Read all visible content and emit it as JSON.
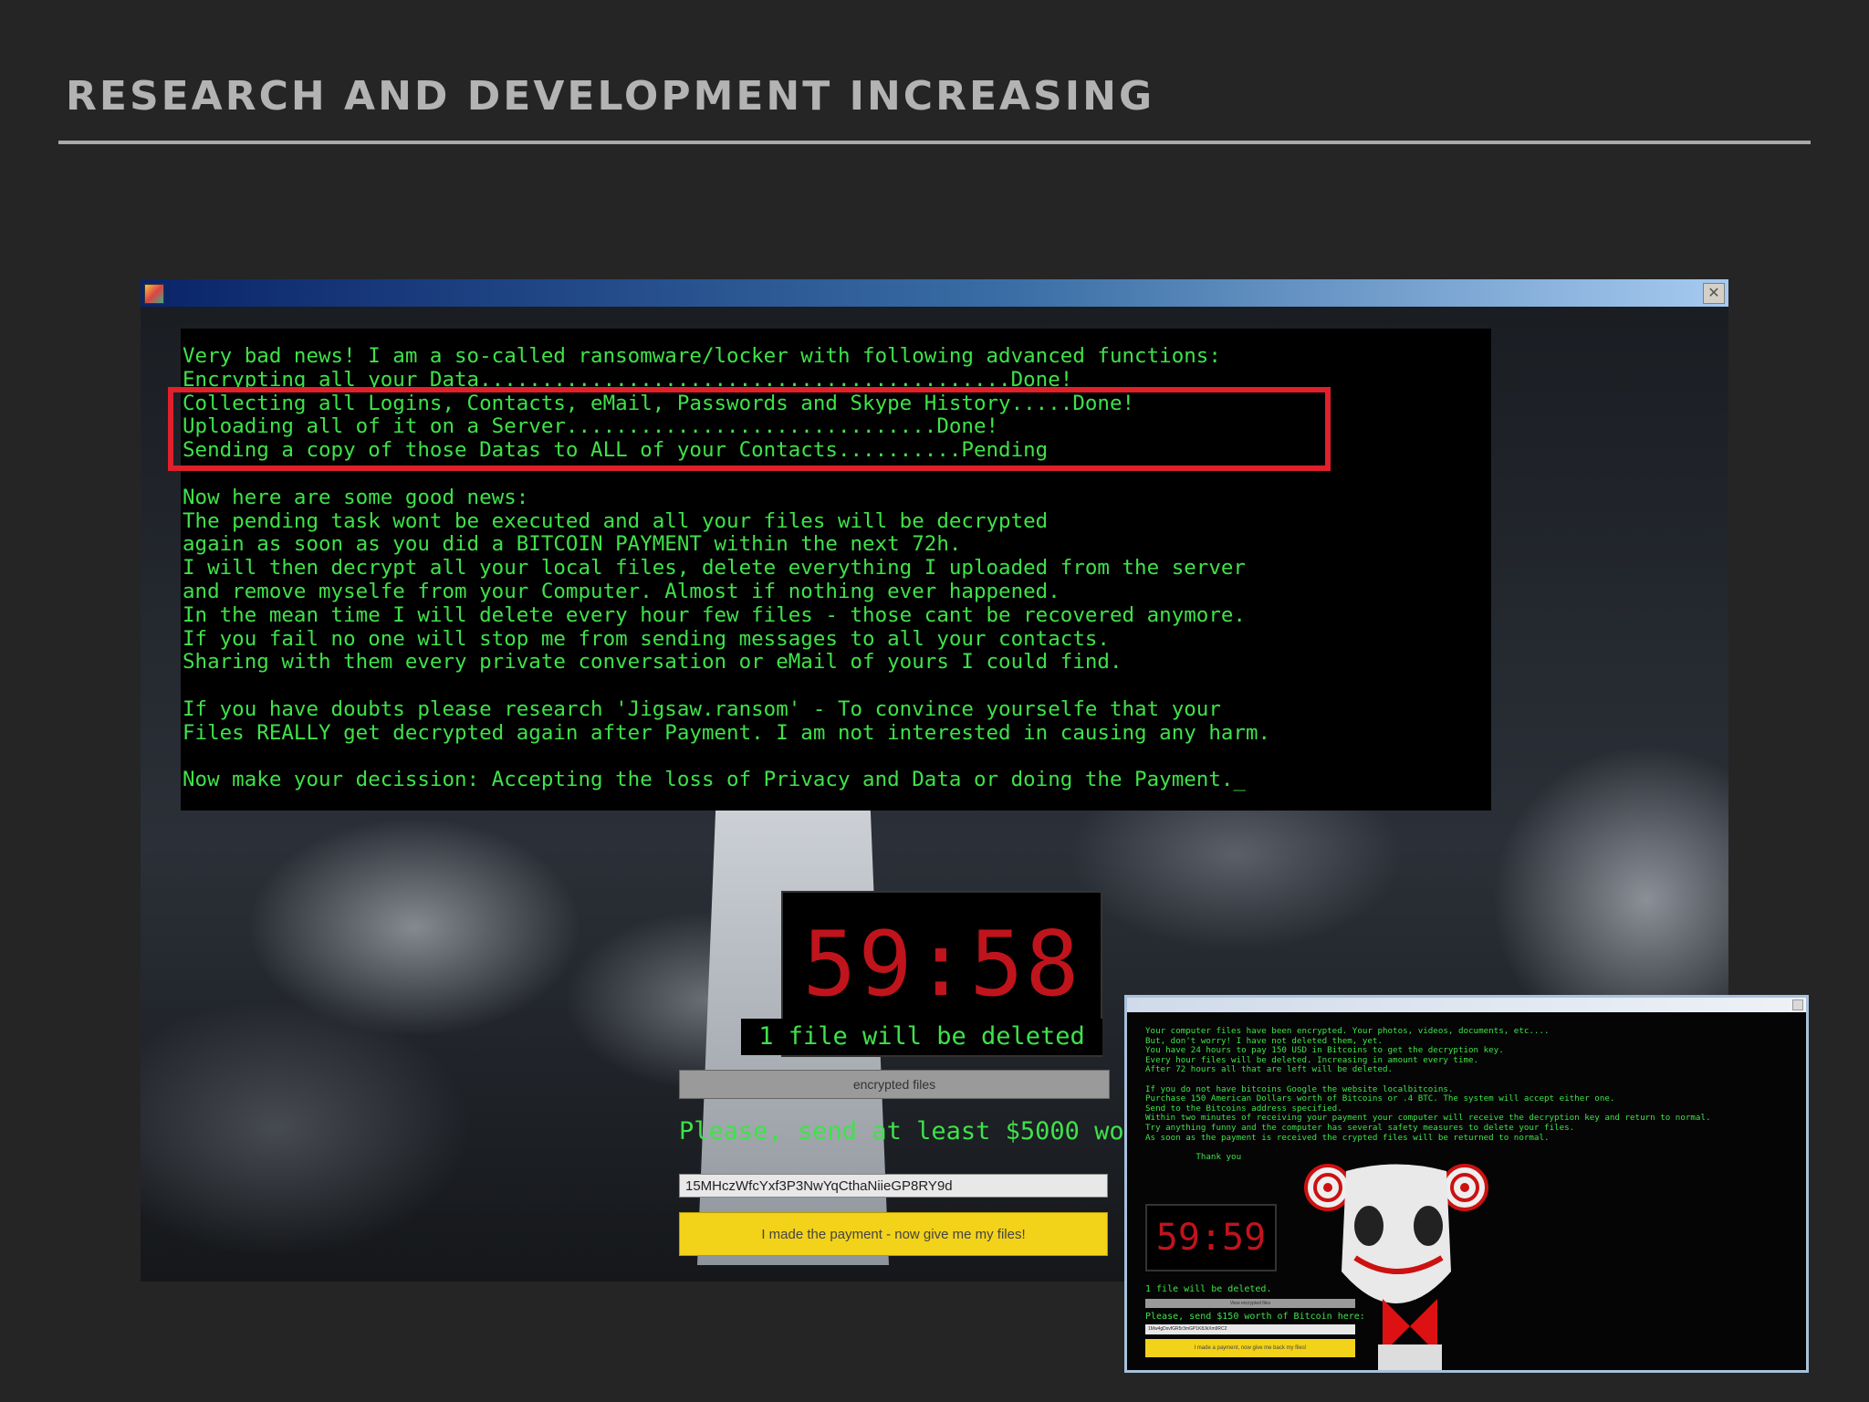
{
  "slide": {
    "title": "RESEARCH AND DEVELOPMENT INCREASING"
  },
  "main_window": {
    "icon": "app-icon",
    "close_label": "✕",
    "message": "Very bad news! I am a so-called ransomware/locker with following advanced functions:\nEncrypting all your Data...........................................Done!\nCollecting all Logins, Contacts, eMail, Passwords and Skype History.....Done!\nUploading all of it on a Server..............................Done!\nSending a copy of those Datas to ALL of your Contacts..........Pending\n\nNow here are some good news:\nThe pending task wont be executed and all your files will be decrypted\nagain as soon as you did a BITCOIN PAYMENT within the next 72h.\nI will then decrypt all your local files, delete everything I uploaded from the server\nand remove myselfe from your Computer. Almost if nothing ever happened.\nIn the mean time I will delete every hour few files - those cant be recovered anymore.\nIf you fail no one will stop me from sending messages to all your contacts.\nSharing with them every private conversation or eMail of yours I could find.\n\nIf you have doubts please research 'Jigsaw.ransom' - To convince yourselfe that your\nFiles REALLY get decrypted again after Payment. I am not interested in causing any harm.\n\nNow make your decission: Accepting the loss of Privacy and Data or doing the Payment._",
    "timer": "59:58",
    "file_warning": "1 file will be deleted",
    "progress_label": "encrypted files",
    "send_text": "Please, send at least $5000 wo",
    "bitcoin_address": "15MHczWfcYxf3P3NwYqCthaNiieGP8RY9d",
    "pay_button": "I made the payment - now give me my files!"
  },
  "inset_window": {
    "message": "Your computer files have been encrypted. Your photos, videos, documents, etc....\nBut, don't worry! I have not deleted them, yet.\nYou have 24 hours to pay 150 USD in Bitcoins to get the decryption key.\nEvery hour files will be deleted. Increasing in amount every time.\nAfter 72 hours all that are left will be deleted.\n\nIf you do not have bitcoins Google the website localbitcoins.\nPurchase 150 American Dollars worth of Bitcoins or .4 BTC. The system will accept either one.\nSend to the Bitcoins address specified.\nWithin two minutes of receiving your payment your computer will receive the decryption key and return to normal.\nTry anything funny and the computer has several safety measures to delete your files.\nAs soon as the payment is received the crypted files will be returned to normal.\n\n          Thank you",
    "timer": "59:59",
    "file_warning": "1 file will be deleted.",
    "progress_label": "View encrypted files",
    "send_text": "Please, send $150 worth of Bitcoin here:",
    "bitcoin_address": "1Mw4gDxvfGR5r3mGP1K8JkXm9RC2",
    "pay_button": "I made a payment, now give me back my files!"
  },
  "colors": {
    "terminal_green": "#3fe24a",
    "timer_red": "#c0141c",
    "highlight_red": "#e0202b",
    "button_yellow": "#f3d21a"
  }
}
